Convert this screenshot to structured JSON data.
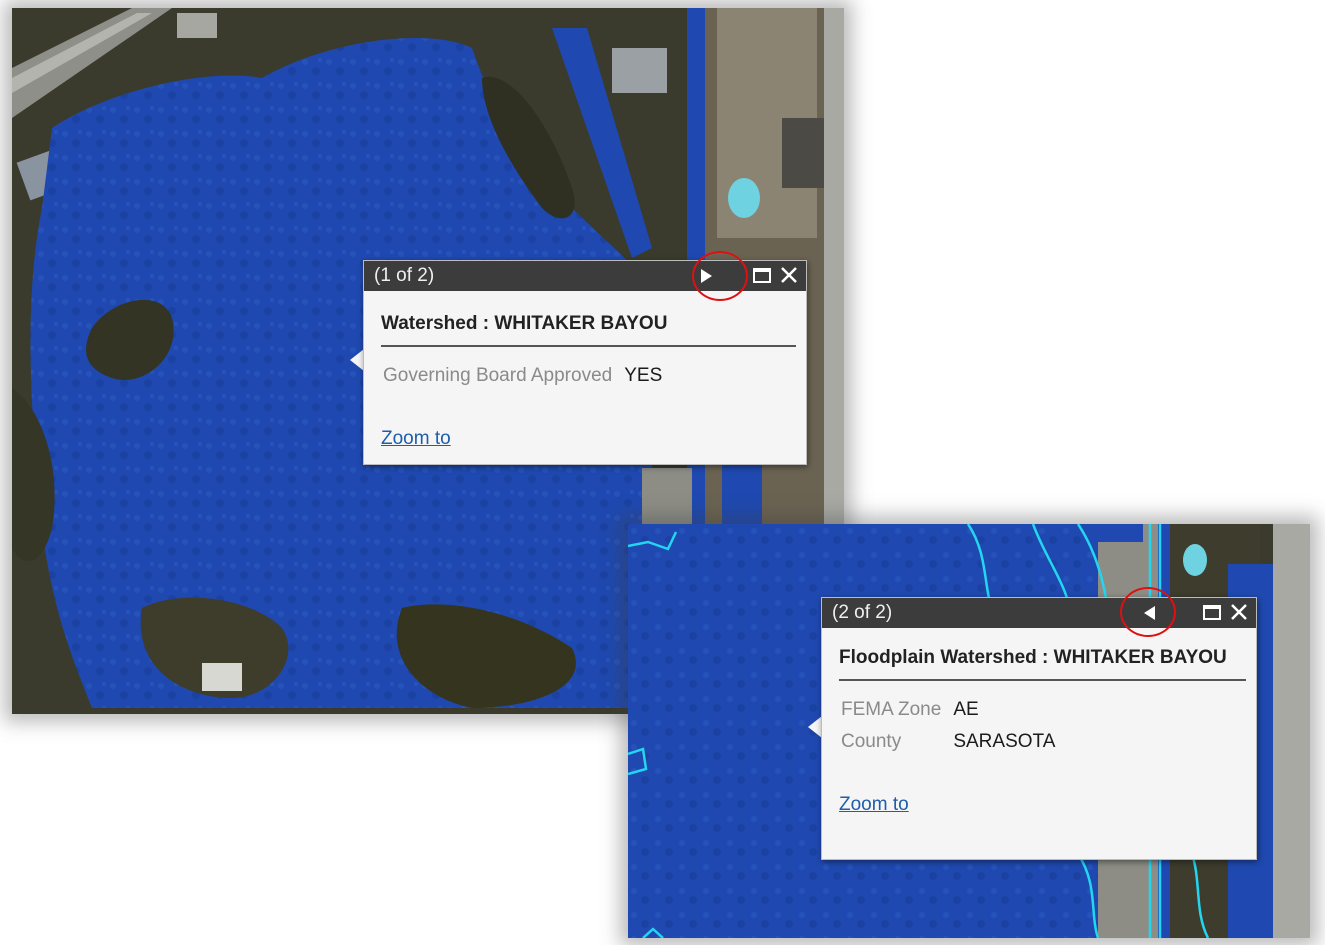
{
  "popup1": {
    "counter": "(1 of 2)",
    "heading": "Watershed : WHITAKER BAYOU",
    "fields": [
      {
        "label": "Governing Board Approved",
        "value": "YES"
      }
    ],
    "zoom_label": "Zoom to",
    "nav_icon": "next-arrow-icon"
  },
  "popup2": {
    "counter": "(2 of 2)",
    "heading": "Floodplain Watershed : WHITAKER BAYOU",
    "fields": [
      {
        "label": "FEMA Zone",
        "value": "AE"
      },
      {
        "label": "County",
        "value": "SARASOTA"
      }
    ],
    "zoom_label": "Zoom to",
    "nav_icon": "previous-arrow-icon"
  },
  "colors": {
    "watershed_fill": "#1f49b0",
    "floodplain_outline": "#23d6f0",
    "highlight_circle": "#dd1111",
    "titlebar": "#3c3c3c",
    "link": "#1d5dab"
  }
}
